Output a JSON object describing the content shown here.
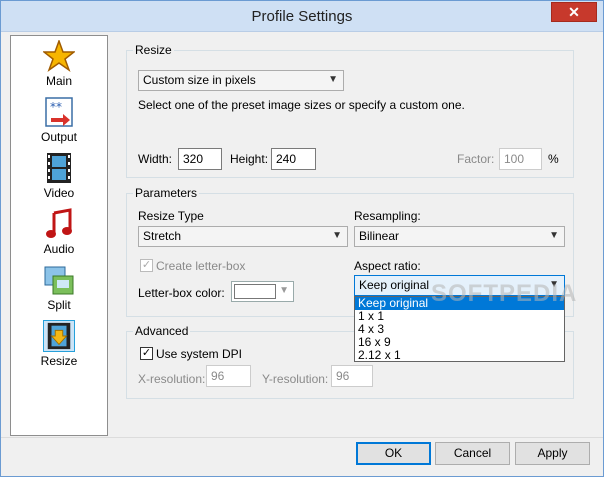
{
  "window": {
    "title": "Profile Settings",
    "close": "✕"
  },
  "sidebar": {
    "items": [
      {
        "label": "Main",
        "icon": "star-icon"
      },
      {
        "label": "Output",
        "icon": "output-icon"
      },
      {
        "label": "Video",
        "icon": "film-icon"
      },
      {
        "label": "Audio",
        "icon": "music-note-icon"
      },
      {
        "label": "Split",
        "icon": "split-icon"
      },
      {
        "label": "Resize",
        "icon": "resize-icon",
        "selected": true
      }
    ]
  },
  "resize": {
    "title": "Resize",
    "preset": "Custom size in pixels",
    "description": "Select one of the preset image sizes or specify a custom one.",
    "width_label": "Width:",
    "width": "320",
    "height_label": "Height:",
    "height": "240",
    "factor_label": "Factor:",
    "factor": "100",
    "percent": "%"
  },
  "parameters": {
    "title": "Parameters",
    "resize_type_label": "Resize Type",
    "resize_type": "Stretch",
    "resampling_label": "Resampling:",
    "resampling": "Bilinear",
    "letterbox_label": "Create letter-box",
    "letterbox_checked": true,
    "letterbox_color_label": "Letter-box color:",
    "aspect_label": "Aspect ratio:",
    "aspect_value": "Keep original",
    "aspect_options": [
      "Keep original",
      "1 x 1",
      "4 x 3",
      "16 x 9",
      "2.12 x 1"
    ]
  },
  "advanced": {
    "title": "Advanced",
    "system_dpi_label": "Use system DPI",
    "system_dpi_checked": true,
    "xres_label": "X-resolution:",
    "xres": "96",
    "yres_label": "Y-resolution:",
    "yres": "96"
  },
  "footer": {
    "ok": "OK",
    "cancel": "Cancel",
    "apply": "Apply"
  },
  "watermark": "SOFTPEDIA",
  "colors": {
    "accent": "#0078d7",
    "titlebar": "#cfe0f4",
    "close": "#c7392c"
  }
}
